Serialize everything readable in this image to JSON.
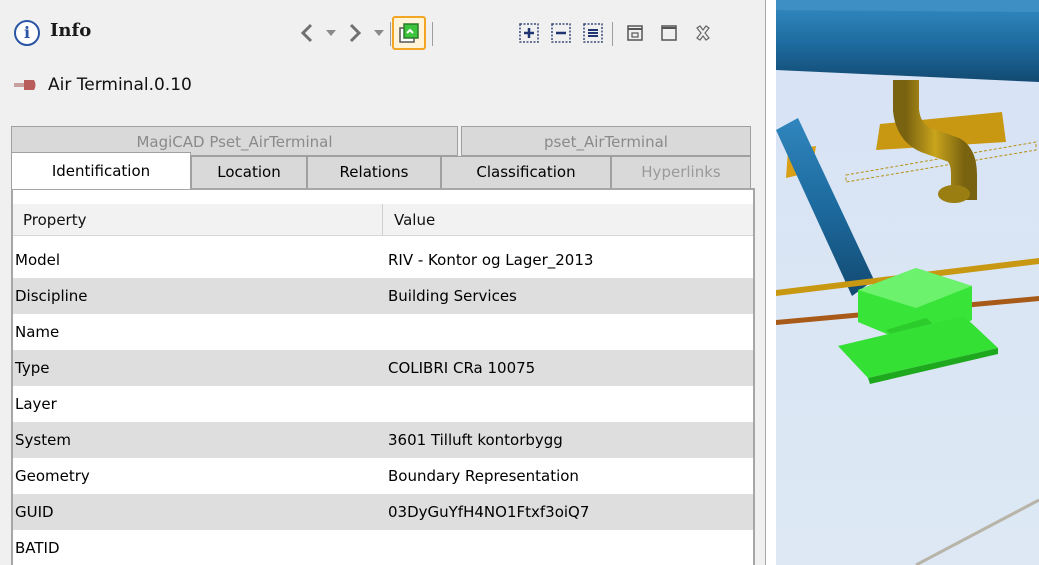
{
  "panel": {
    "title": "Info",
    "object_name": "Air Terminal.0.10",
    "toolbar": {
      "back_icon": "chevron-left-icon",
      "forward_icon": "chevron-right-icon",
      "sync_icon": "sync-selection-icon",
      "expand_icon": "expand-all-icon",
      "collapse_icon": "collapse-all-icon",
      "list_icon": "list-view-icon",
      "restore_icon": "restore-icon",
      "maximize_icon": "maximize-icon",
      "close_icon": "close-icon"
    },
    "tabs_back": [
      {
        "label": "MagiCAD Pset_AirTerminal"
      },
      {
        "label": "pset_AirTerminal"
      }
    ],
    "tabs_front": [
      {
        "label": "Identification",
        "active": true
      },
      {
        "label": "Location"
      },
      {
        "label": "Relations"
      },
      {
        "label": "Classification"
      },
      {
        "label": "Hyperlinks",
        "disabled": true
      }
    ],
    "grid": {
      "columns": [
        "Property",
        "Value"
      ],
      "rows": [
        {
          "property": "Model",
          "value": "RIV - Kontor og Lager_2013"
        },
        {
          "property": "Discipline",
          "value": "Building Services"
        },
        {
          "property": "Name",
          "value": ""
        },
        {
          "property": "Type",
          "value": "COLIBRI CRa 10075"
        },
        {
          "property": "Layer",
          "value": ""
        },
        {
          "property": "System",
          "value": "3601 Tilluft kontorbygg"
        },
        {
          "property": "Geometry",
          "value": "Boundary Representation"
        },
        {
          "property": "GUID",
          "value": "03DyGuYfH4NO1Ftxf3oiQ7"
        },
        {
          "property": "BATID",
          "value": ""
        }
      ]
    }
  },
  "colors": {
    "duct_blue": "#1f6fa3",
    "pipe_olive": "#b38f12",
    "air_terminal_green": "#2de02d",
    "highlight_orange": "#f3a623"
  }
}
